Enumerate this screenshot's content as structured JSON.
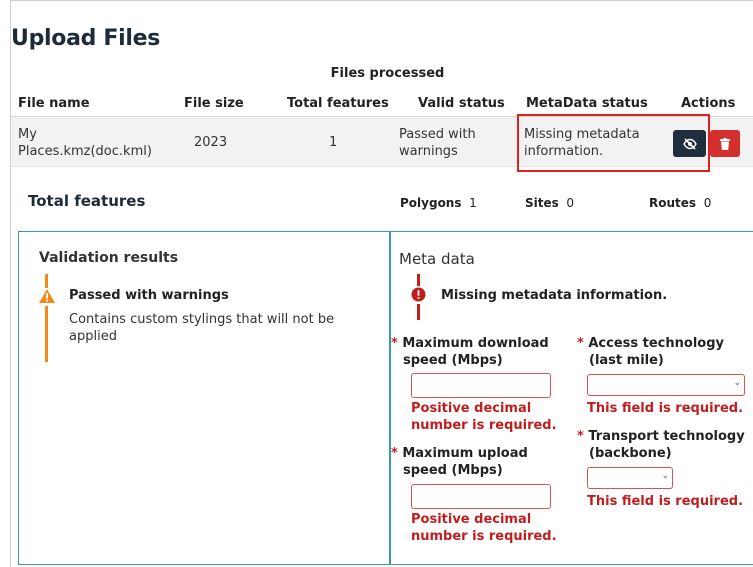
{
  "page": {
    "title": "Upload Files"
  },
  "table": {
    "caption": "Files processed",
    "headers": {
      "file_name": "File name",
      "file_size": "File size",
      "total_features": "Total features",
      "valid_status": "Valid status",
      "metadata_status": "MetaData status",
      "actions": "Actions"
    },
    "rows": [
      {
        "file_name_line1": "My",
        "file_name_line2": "Places.kmz(doc.kml)",
        "file_size": "2023",
        "total_features": "1",
        "valid_status_line1": "Passed with",
        "valid_status_line2": "warnings",
        "metadata_status_line1": "Missing metadata",
        "metadata_status_line2": "information."
      }
    ],
    "actions": {
      "view_icon": "eye-slash-icon",
      "delete_icon": "trash-icon"
    }
  },
  "summary": {
    "label": "Total features",
    "polygons_label": "Polygons",
    "polygons_value": "1",
    "sites_label": "Sites",
    "sites_value": "0",
    "routes_label": "Routes",
    "routes_value": "0"
  },
  "validation": {
    "title": "Validation results",
    "status": "Passed with warnings",
    "message_line1": "Contains custom stylings that will not be",
    "message_line2": "applied",
    "icon": "warning-triangle-icon"
  },
  "metadata": {
    "title": "Meta data",
    "status": "Missing metadata information.",
    "icon": "error-circle-icon",
    "required_mark": "*",
    "fields": {
      "max_download": {
        "label_line1": "Maximum download",
        "label_line2": "speed (Mbps)",
        "value": "",
        "error_line1": "Positive decimal",
        "error_line2": "number is required."
      },
      "max_upload": {
        "label_line1": "Maximum upload",
        "label_line2": "speed (Mbps)",
        "value": "",
        "error_line1": "Positive decimal",
        "error_line2": "number is required."
      },
      "access_technology": {
        "label_line1": "Access technology",
        "label_line2": "(last mile)",
        "selected": "",
        "error": "This field is required."
      },
      "transport_technology": {
        "label_line1": "Transport technology",
        "label_line2": "(backbone)",
        "selected": "",
        "error": "This field is required."
      }
    }
  },
  "colors": {
    "accent_teal": "#3a9aa8",
    "error_red": "#c01e1e",
    "warning_orange": "#f28a1b",
    "dark_button": "#1f2d3d",
    "delete_button": "#d32f2f"
  }
}
